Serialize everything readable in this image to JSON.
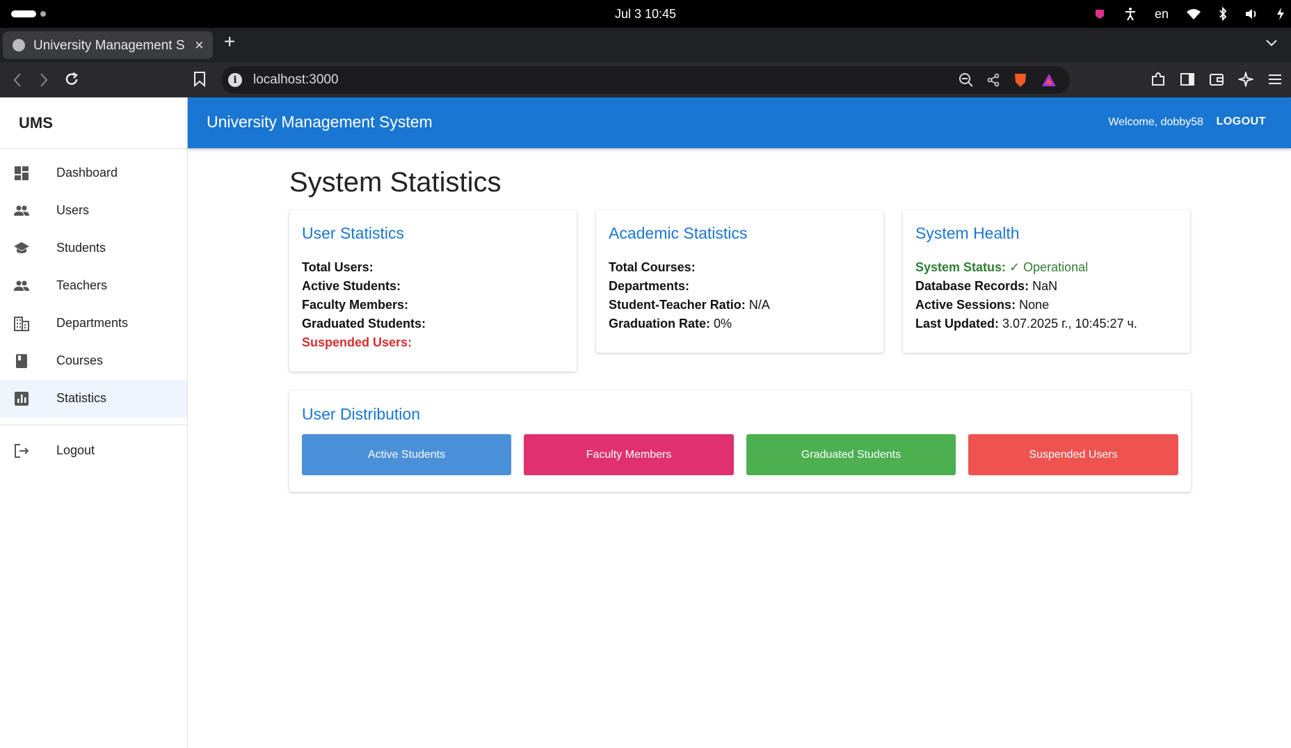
{
  "os": {
    "clock": "Jul 3  10:45",
    "lang": "en"
  },
  "browser": {
    "tab_title": "University Management S",
    "url": "localhost:3000"
  },
  "sidebar": {
    "brand": "UMS",
    "items": [
      {
        "label": "Dashboard",
        "icon": "dashboard-icon"
      },
      {
        "label": "Users",
        "icon": "people-icon"
      },
      {
        "label": "Students",
        "icon": "school-icon"
      },
      {
        "label": "Teachers",
        "icon": "people-icon"
      },
      {
        "label": "Departments",
        "icon": "building-icon"
      },
      {
        "label": "Courses",
        "icon": "book-icon"
      },
      {
        "label": "Statistics",
        "icon": "bar-chart-icon",
        "active": true
      }
    ],
    "logout_label": "Logout"
  },
  "appbar": {
    "title": "University Management System",
    "welcome": "Welcome, dobby58",
    "logout": "LOGOUT"
  },
  "page": {
    "title": "System Statistics"
  },
  "user_stats": {
    "title": "User Statistics",
    "total_users": "Total Users:",
    "active_students": "Active Students:",
    "faculty_members": "Faculty Members:",
    "graduated_students": "Graduated Students:",
    "suspended_users": "Suspended Users:"
  },
  "academic_stats": {
    "title": "Academic Statistics",
    "total_courses": "Total Courses:",
    "departments": "Departments:",
    "ratio_label": "Student-Teacher Ratio:",
    "ratio_value": " N/A",
    "grad_rate_label": "Graduation Rate:",
    "grad_rate_value": " 0%"
  },
  "system_health": {
    "title": "System Health",
    "status_label": "System Status:",
    "status_value": " ✓ Operational",
    "db_label": "Database Records:",
    "db_value": " NaN",
    "sessions_label": "Active Sessions:",
    "sessions_value": " None",
    "updated_label": "Last Updated:",
    "updated_value": " 3.07.2025 г., 10:45:27 ч."
  },
  "distribution": {
    "title": "User Distribution",
    "bars": [
      {
        "label": "Active Students",
        "color": "#4a90d9"
      },
      {
        "label": "Faculty Members",
        "color": "#e0306e"
      },
      {
        "label": "Graduated Students",
        "color": "#4caf50"
      },
      {
        "label": "Suspended Users",
        "color": "#ef5350"
      }
    ]
  },
  "colors": {
    "primary": "#1976d2",
    "error": "#d32f2f",
    "success": "#2e7d32"
  }
}
